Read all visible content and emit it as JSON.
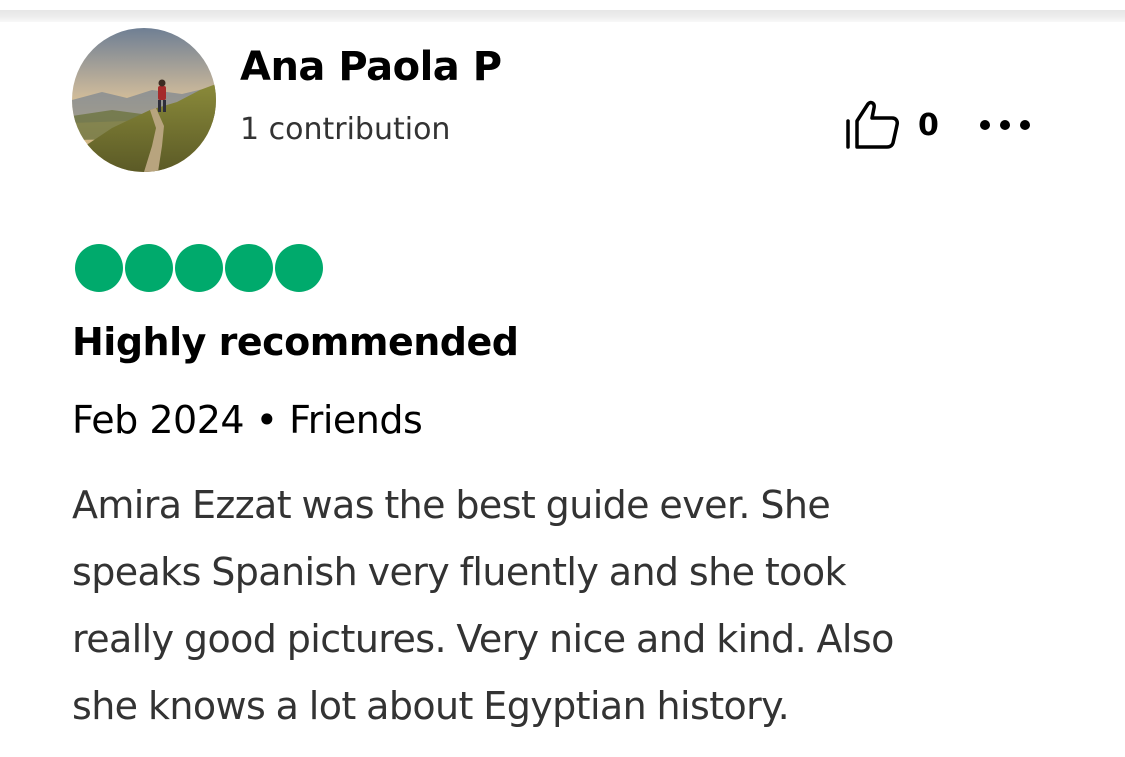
{
  "review": {
    "author": {
      "name": "Ana Paola P",
      "contributions": "1 contribution",
      "avatar_icon": "avatar-photo-mountain-hiker"
    },
    "helpful": {
      "icon": "thumbs-up-icon",
      "count": "0"
    },
    "more_icon": "more-options-icon",
    "rating": {
      "value": 5,
      "max": 5,
      "color": "#00aa6c"
    },
    "title": "Highly recommended",
    "meta": "Feb 2024 • Friends",
    "body_lines": [
      "Amira Ezzat was the best guide ever. She",
      "speaks Spanish very fluently and she took",
      "really good pictures. Very nice and kind. Also",
      "she knows a lot about Egyptian history."
    ]
  }
}
